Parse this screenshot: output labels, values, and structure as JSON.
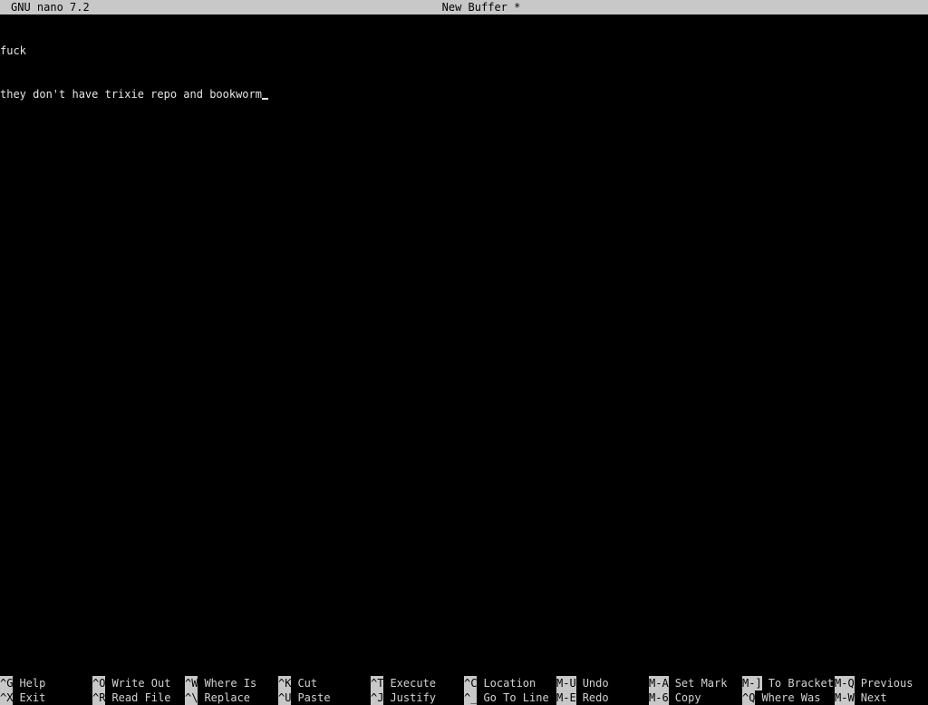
{
  "header": {
    "app_version": "GNU nano 7.2",
    "buffer_name": "New Buffer *"
  },
  "editor": {
    "lines": [
      "fuck",
      "they don't have trixie repo and bookworm"
    ]
  },
  "shortcuts": {
    "help": {
      "key": "^G",
      "label": "Help"
    },
    "exit": {
      "key": "^X",
      "label": "Exit"
    },
    "write_out": {
      "key": "^O",
      "label": "Write Out"
    },
    "read_file": {
      "key": "^R",
      "label": "Read File"
    },
    "where_is": {
      "key": "^W",
      "label": "Where Is"
    },
    "replace": {
      "key": "^\\",
      "label": "Replace"
    },
    "cut": {
      "key": "^K",
      "label": "Cut"
    },
    "paste": {
      "key": "^U",
      "label": "Paste"
    },
    "execute": {
      "key": "^T",
      "label": "Execute"
    },
    "justify": {
      "key": "^J",
      "label": "Justify"
    },
    "location": {
      "key": "^C",
      "label": "Location"
    },
    "go_to_line": {
      "key": "^_",
      "label": "Go To Line"
    },
    "undo": {
      "key": "M-U",
      "label": "Undo"
    },
    "redo": {
      "key": "M-E",
      "label": "Redo"
    },
    "set_mark": {
      "key": "M-A",
      "label": "Set Mark"
    },
    "copy": {
      "key": "M-6",
      "label": "Copy"
    },
    "to_bracket": {
      "key": "M-]",
      "label": "To Bracket"
    },
    "where_was": {
      "key": "^Q",
      "label": "Where Was"
    },
    "previous": {
      "key": "M-Q",
      "label": "Previous"
    },
    "next": {
      "key": "M-W",
      "label": "Next"
    }
  },
  "colors": {
    "background": "#000000",
    "bar": "#c8c8c8",
    "text": "#e6e6e6"
  }
}
